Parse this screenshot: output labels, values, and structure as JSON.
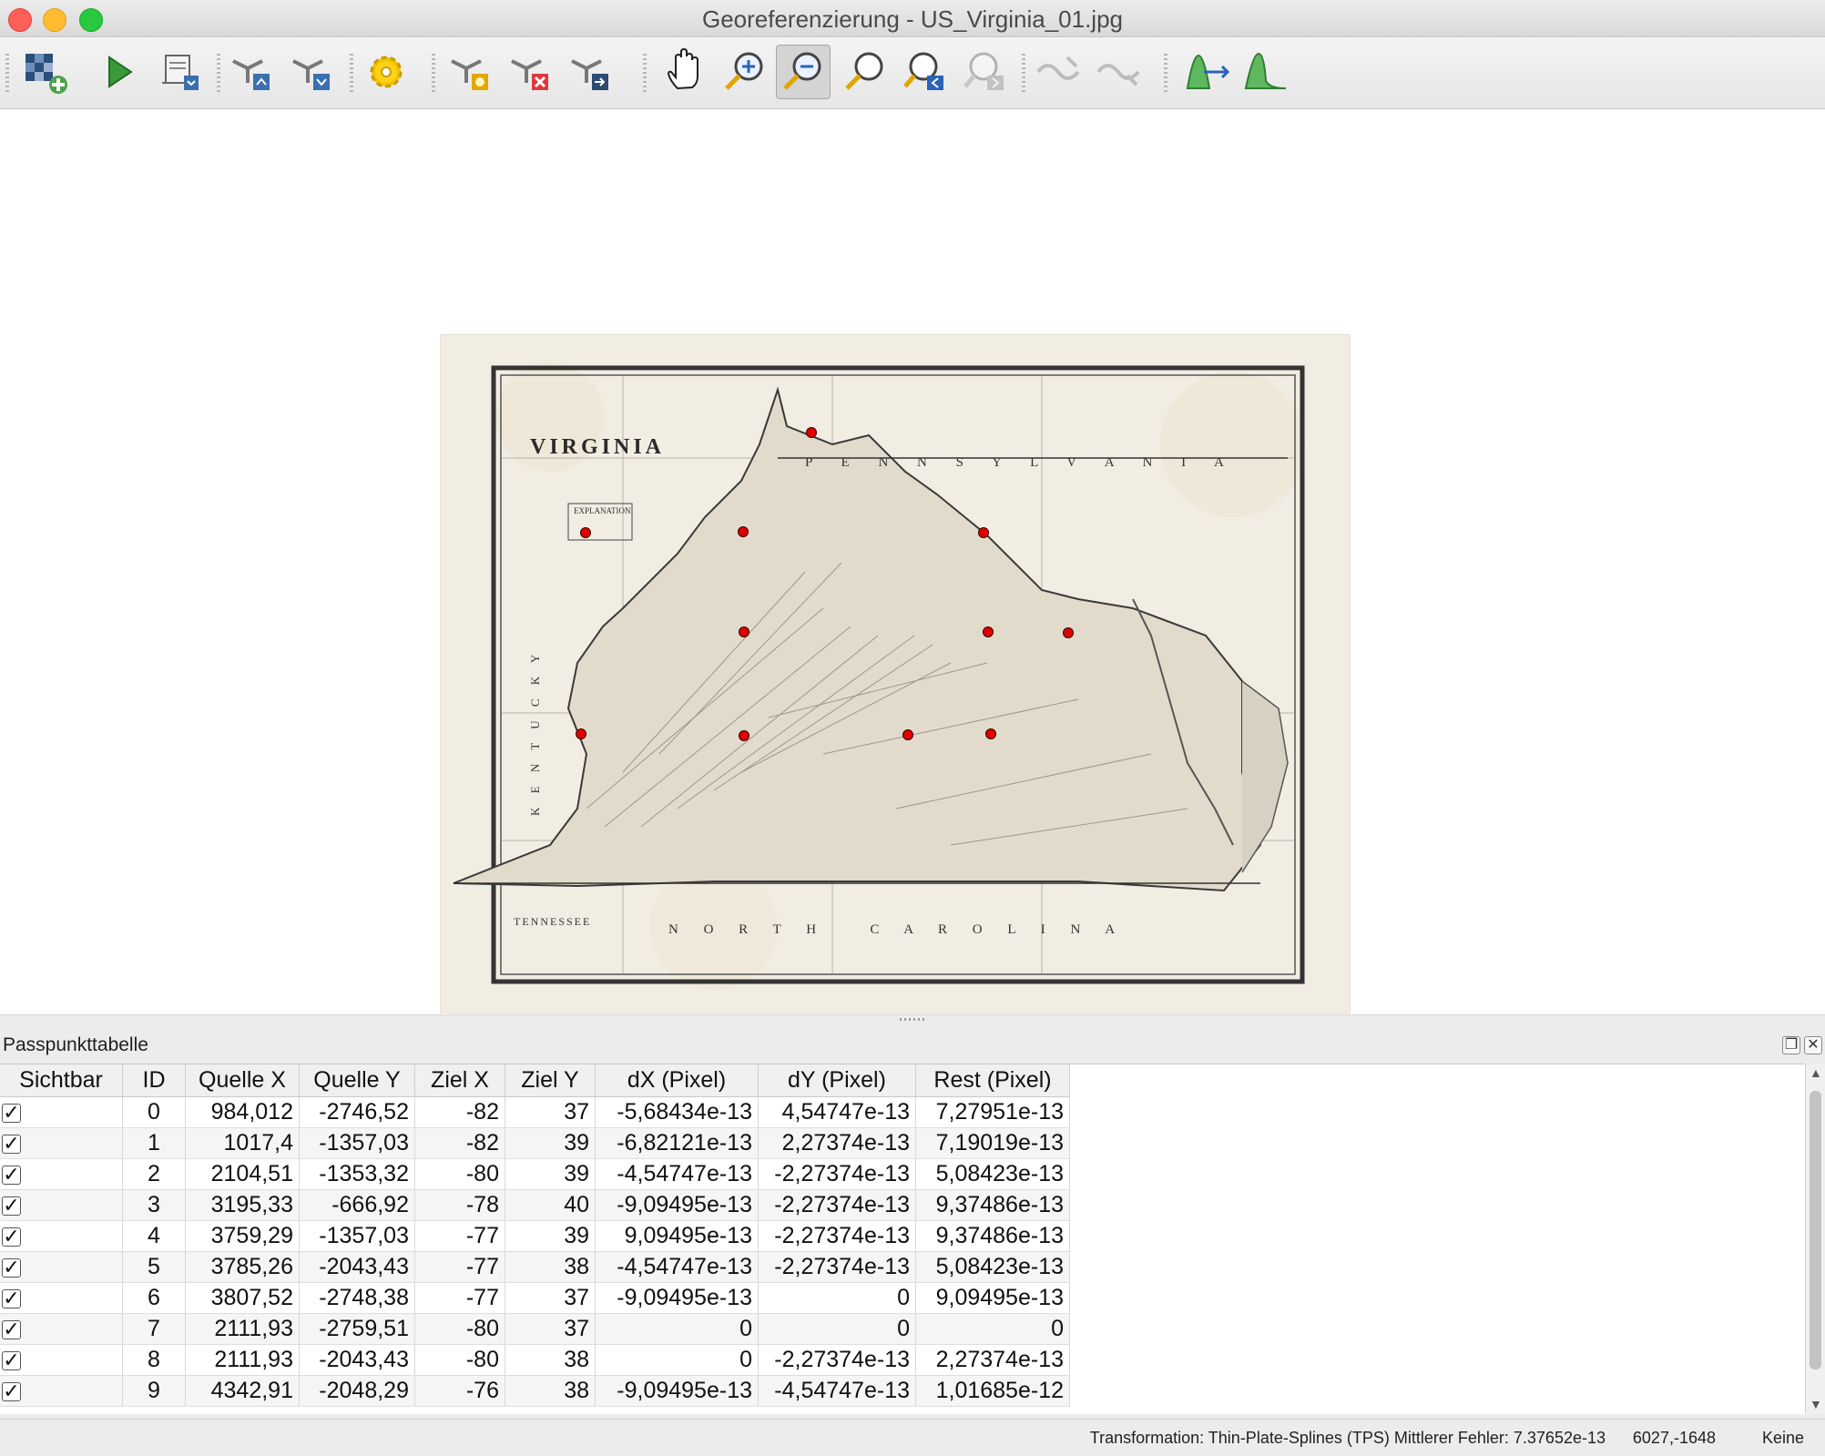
{
  "window": {
    "title": "Georeferenzierung - US_Virginia_01.jpg"
  },
  "toolbar": {
    "buttons": [
      {
        "icon": "open-raster-icon",
        "enabled": true
      },
      {
        "icon": "start-georeferencing-icon",
        "enabled": true
      },
      {
        "icon": "generate-gdal-script-icon",
        "enabled": true
      },
      {
        "icon": "load-gcp-points-icon",
        "enabled": true
      },
      {
        "icon": "save-gcp-points-icon",
        "enabled": true
      },
      {
        "icon": "transformation-settings-icon",
        "enabled": true
      },
      {
        "icon": "add-point-icon",
        "enabled": true
      },
      {
        "icon": "delete-point-icon",
        "enabled": true
      },
      {
        "icon": "move-gcp-point-icon",
        "enabled": true
      },
      {
        "icon": "pan-icon",
        "enabled": true
      },
      {
        "icon": "zoom-in-icon",
        "enabled": true
      },
      {
        "icon": "zoom-out-icon",
        "enabled": true,
        "active": true
      },
      {
        "icon": "zoom-to-layer-icon",
        "enabled": true
      },
      {
        "icon": "zoom-last-icon",
        "enabled": true
      },
      {
        "icon": "zoom-next-icon",
        "enabled": false
      },
      {
        "icon": "link-georef-to-qgis-icon",
        "enabled": false
      },
      {
        "icon": "link-qgis-to-georef-icon",
        "enabled": false
      },
      {
        "icon": "full-histogram-stretch-icon",
        "enabled": true
      },
      {
        "icon": "local-histogram-stretch-icon",
        "enabled": true
      }
    ]
  },
  "map": {
    "title": "VIRGINIA",
    "state_label_north": "P E N N S Y L V A N I A",
    "state_label_south": "N O R T H   C A R O L I N A",
    "state_label_west": "K E N T U C K Y",
    "state_label_sw": "TENNESSEE",
    "legend_heading": "EXPLANATION",
    "gcp_color": "#e00000"
  },
  "panel": {
    "title": "Passpunkttabelle",
    "columns": [
      "Sichtbar",
      "ID",
      "Quelle X",
      "Quelle Y",
      "Ziel X",
      "Ziel Y",
      "dX (Pixel)",
      "dY (Pixel)",
      "Rest (Pixel)"
    ],
    "rows": [
      {
        "visible": "✓",
        "id": "0",
        "src_x": "984,012",
        "src_y": "-2746,52",
        "dst_x": "-82",
        "dst_y": "37",
        "dx": "-5,68434e-13",
        "dy": "4,54747e-13",
        "res": "7,27951e-13"
      },
      {
        "visible": "✓",
        "id": "1",
        "src_x": "1017,4",
        "src_y": "-1357,03",
        "dst_x": "-82",
        "dst_y": "39",
        "dx": "-6,82121e-13",
        "dy": "2,27374e-13",
        "res": "7,19019e-13"
      },
      {
        "visible": "✓",
        "id": "2",
        "src_x": "2104,51",
        "src_y": "-1353,32",
        "dst_x": "-80",
        "dst_y": "39",
        "dx": "-4,54747e-13",
        "dy": "-2,27374e-13",
        "res": "5,08423e-13"
      },
      {
        "visible": "✓",
        "id": "3",
        "src_x": "3195,33",
        "src_y": "-666,92",
        "dst_x": "-78",
        "dst_y": "40",
        "dx": "-9,09495e-13",
        "dy": "-2,27374e-13",
        "res": "9,37486e-13"
      },
      {
        "visible": "✓",
        "id": "4",
        "src_x": "3759,29",
        "src_y": "-1357,03",
        "dst_x": "-77",
        "dst_y": "39",
        "dx": "9,09495e-13",
        "dy": "-2,27374e-13",
        "res": "9,37486e-13"
      },
      {
        "visible": "✓",
        "id": "5",
        "src_x": "3785,26",
        "src_y": "-2043,43",
        "dst_x": "-77",
        "dst_y": "38",
        "dx": "-4,54747e-13",
        "dy": "-2,27374e-13",
        "res": "5,08423e-13"
      },
      {
        "visible": "✓",
        "id": "6",
        "src_x": "3807,52",
        "src_y": "-2748,38",
        "dst_x": "-77",
        "dst_y": "37",
        "dx": "-9,09495e-13",
        "dy": "0",
        "res": "9,09495e-13"
      },
      {
        "visible": "✓",
        "id": "7",
        "src_x": "2111,93",
        "src_y": "-2759,51",
        "dst_x": "-80",
        "dst_y": "37",
        "dx": "0",
        "dy": "0",
        "res": "0"
      },
      {
        "visible": "✓",
        "id": "8",
        "src_x": "2111,93",
        "src_y": "-2043,43",
        "dst_x": "-80",
        "dst_y": "38",
        "dx": "0",
        "dy": "-2,27374e-13",
        "res": "2,27374e-13"
      },
      {
        "visible": "✓",
        "id": "9",
        "src_x": "4342,91",
        "src_y": "-2048,29",
        "dst_x": "-76",
        "dst_y": "38",
        "dx": "-9,09495e-13",
        "dy": "-4,54747e-13",
        "res": "1,01685e-12"
      }
    ]
  },
  "statusbar": {
    "transform": "Transformation: Thin-Plate-Splines (TPS) Mittlerer Fehler: 7.37652e-13",
    "coords": "6027,-1648",
    "crs": "Keine"
  }
}
